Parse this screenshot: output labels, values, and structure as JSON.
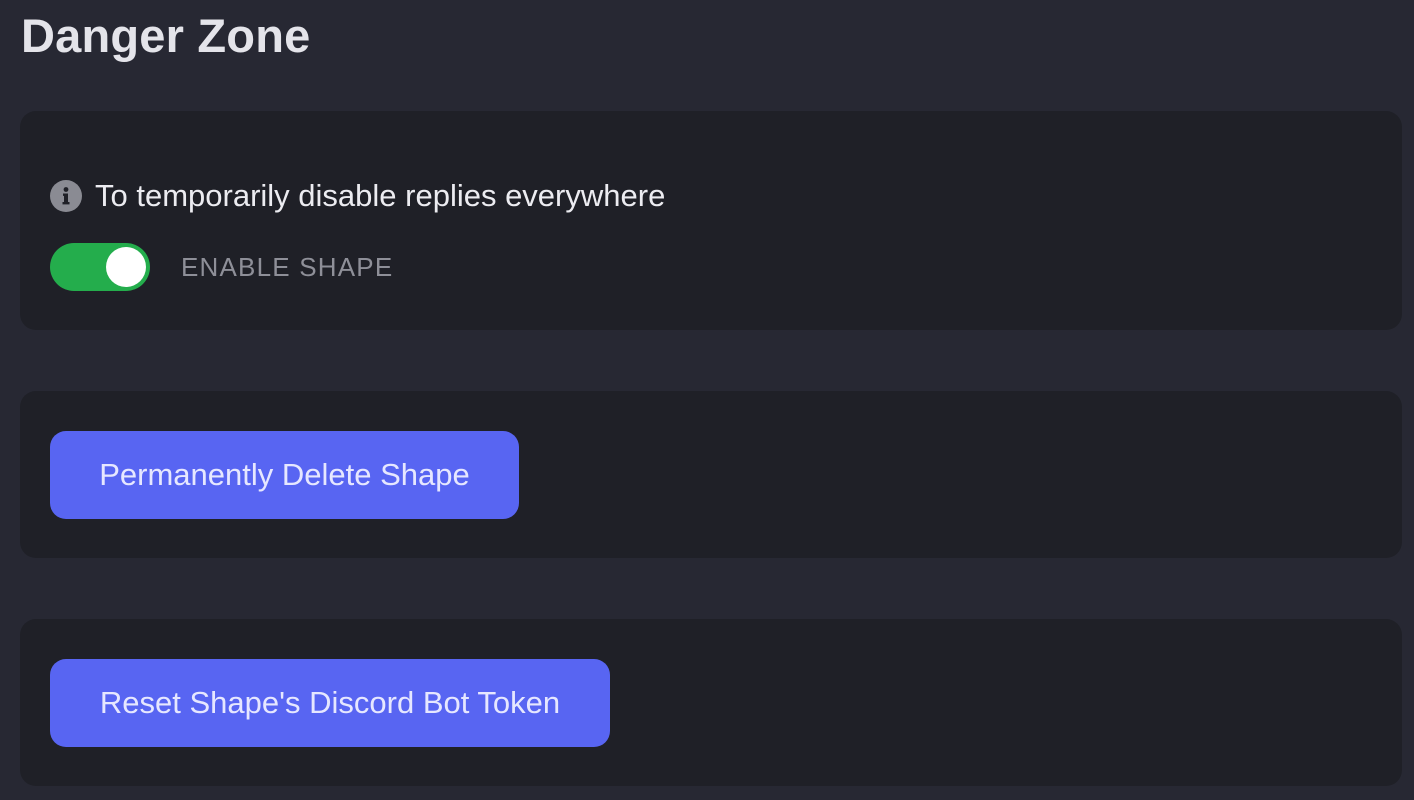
{
  "page": {
    "title": "Danger Zone"
  },
  "enable_section": {
    "info_icon": "info-circle-icon",
    "info_text": "To temporarily disable replies everywhere",
    "toggle": {
      "label": "ENABLE SHAPE",
      "checked": true
    }
  },
  "delete_section": {
    "button_label": "Permanently Delete Shape"
  },
  "reset_section": {
    "button_label": "Reset Shape's Discord Bot Token"
  },
  "colors": {
    "background": "#272833",
    "card": "#1f2027",
    "toggle_on": "#24ad4c",
    "button": "#5865f2",
    "label_muted": "#8e8f98"
  }
}
